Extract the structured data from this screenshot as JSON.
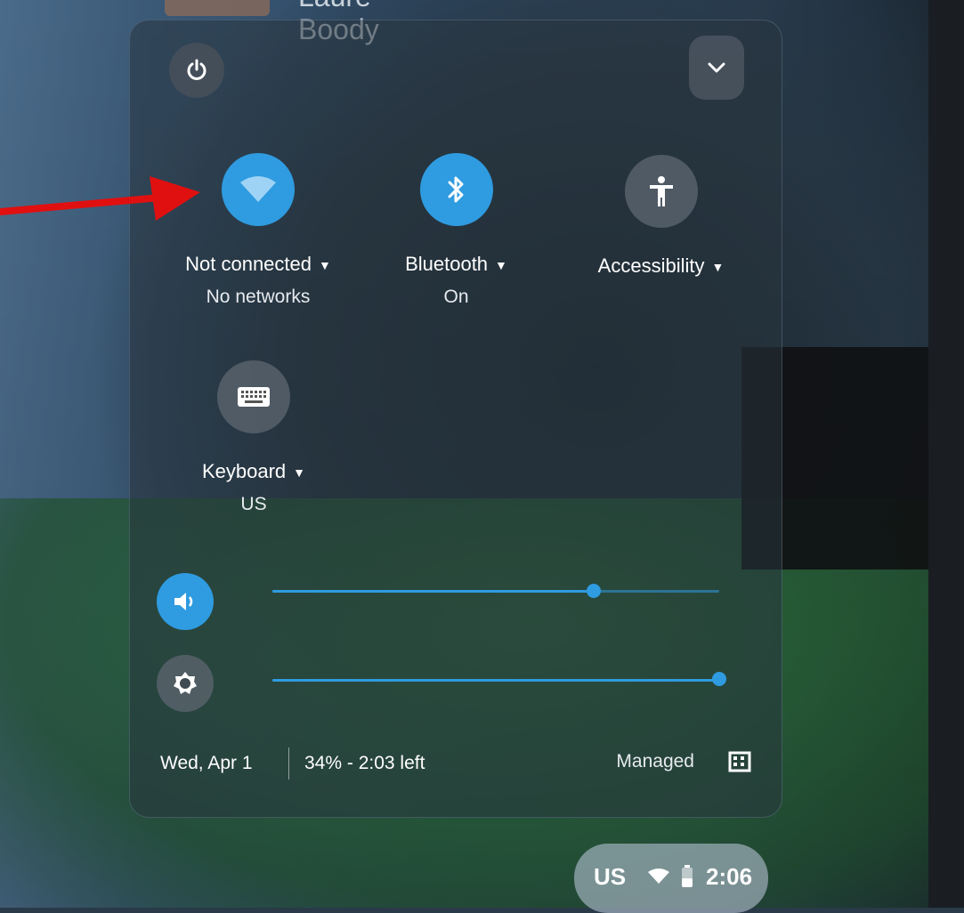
{
  "top_user": {
    "name": "Laure Boody"
  },
  "feature_tiles": {
    "network": {
      "label": "Not connected",
      "sub": "No networks",
      "icon": "wifi-icon",
      "active": true
    },
    "bluetooth": {
      "label": "Bluetooth",
      "sub": "On",
      "icon": "bluetooth-icon",
      "active": true
    },
    "accessibility": {
      "label": "Accessibility",
      "sub": "",
      "icon": "accessibility-icon",
      "active": false
    },
    "keyboard": {
      "label": "Keyboard",
      "sub": "US",
      "icon": "keyboard-icon",
      "active": false
    }
  },
  "sliders": {
    "volume": {
      "icon": "volume-icon",
      "level": 0.72
    },
    "brightness": {
      "icon": "brightness-icon",
      "level": 1.0
    }
  },
  "footer": {
    "date": "Wed, Apr 1",
    "battery": "34% - 2:03 left",
    "managed": "Managed"
  },
  "tray": {
    "ime": "US",
    "time": "2:06"
  },
  "colors": {
    "accent": "#2f9be0",
    "annotation_arrow": "#e01010"
  }
}
